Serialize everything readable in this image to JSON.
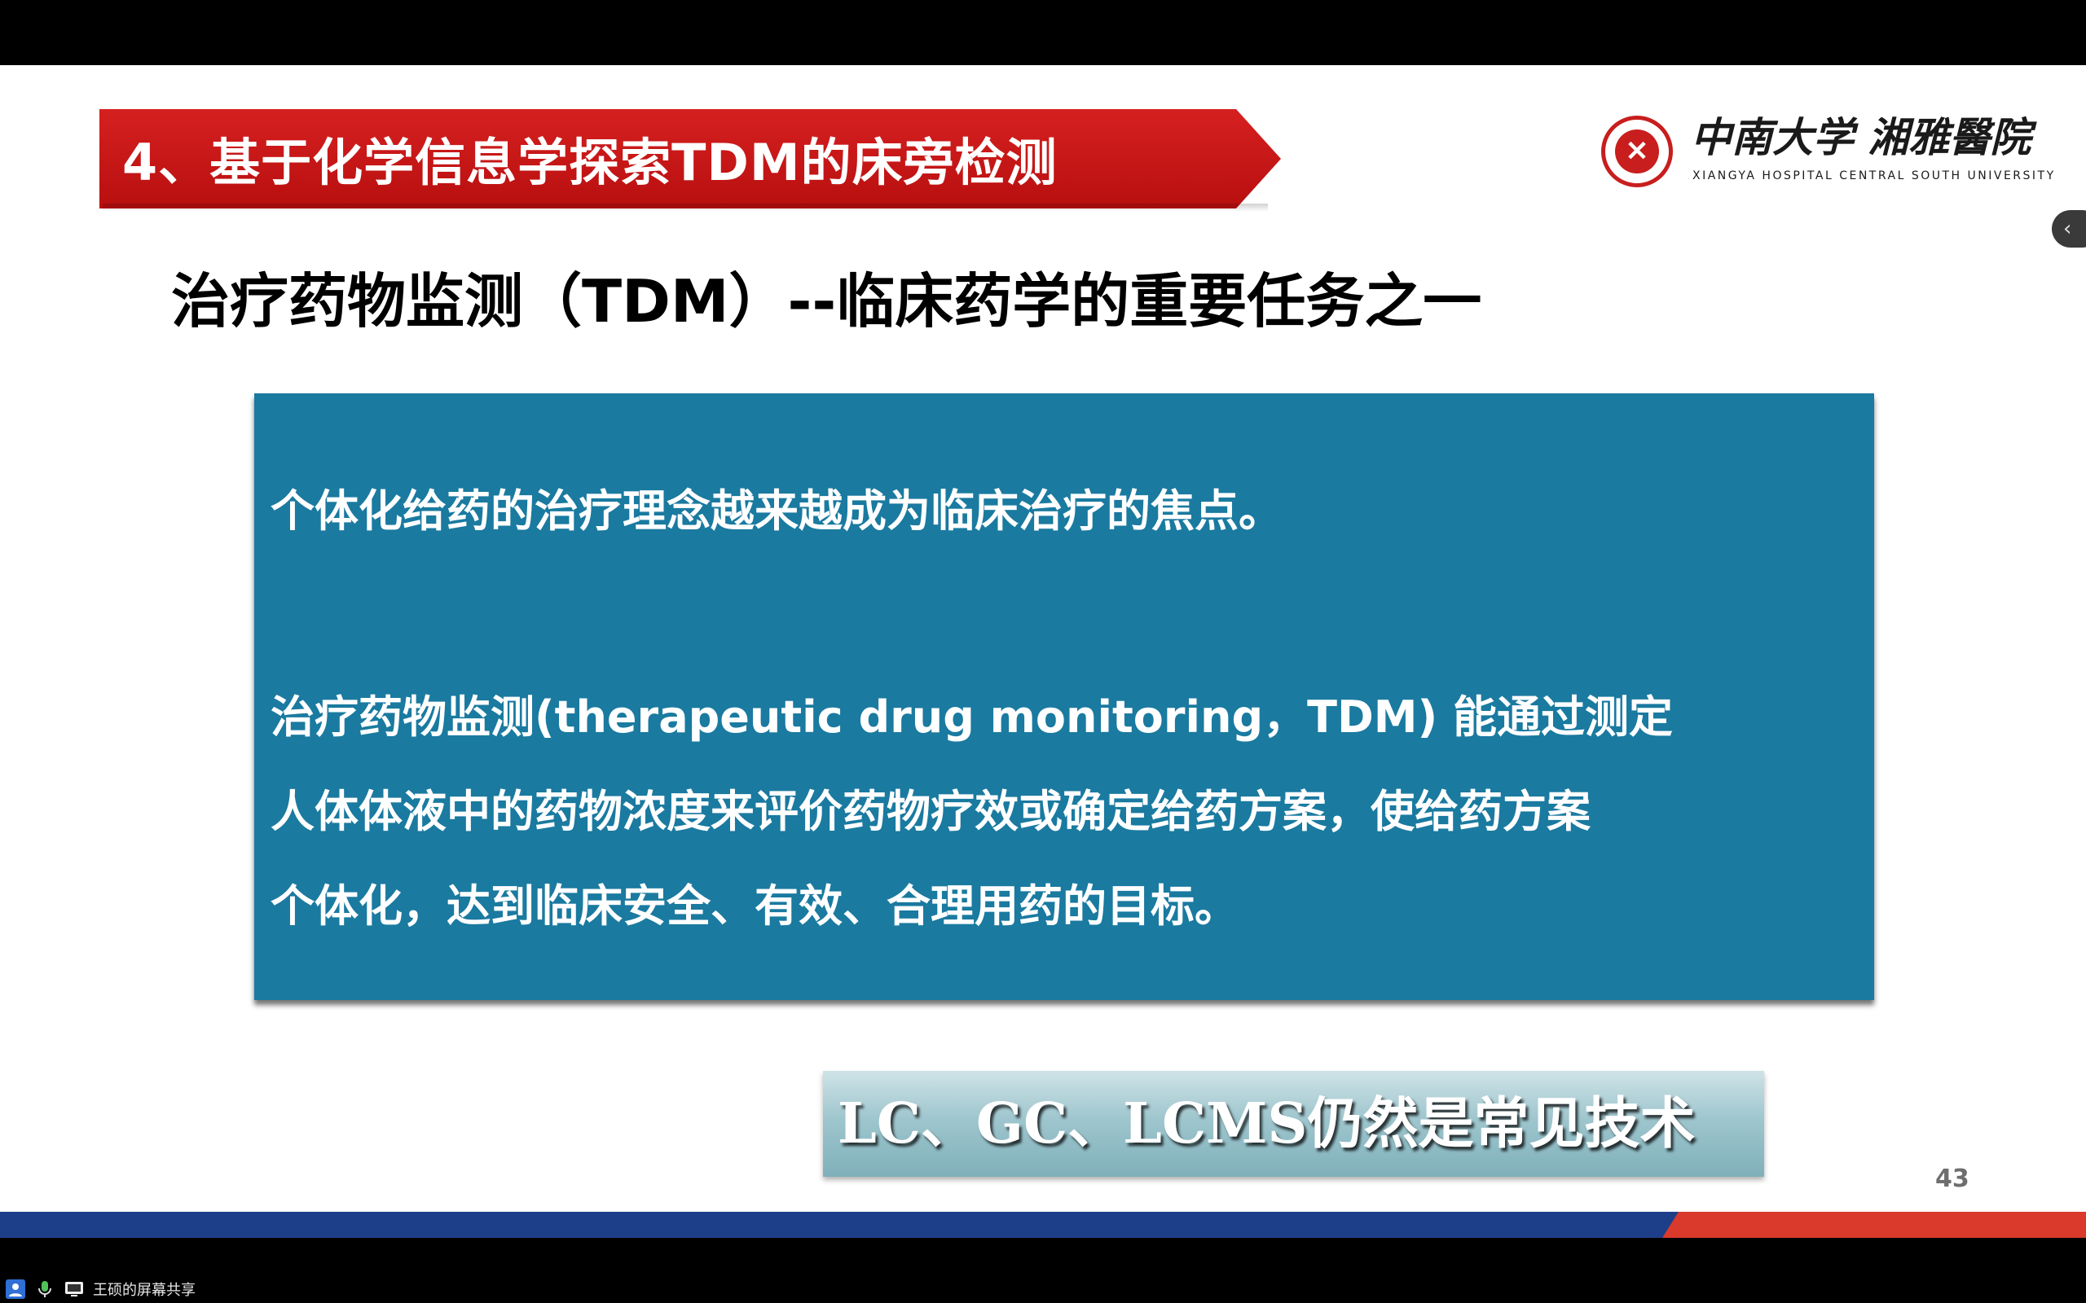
{
  "slide": {
    "title": "4、基于化学信息学探索TDM的床旁检测",
    "logo": {
      "cn": "中南大学 湘雅醫院",
      "en": "XIANGYA HOSPITAL CENTRAL SOUTH UNIVERSITY"
    },
    "subtitle": "治疗药物监测（TDM）--临床药学的重要任务之一",
    "box": {
      "para1": "个体化给药的治疗理念越来越成为临床治疗的焦点。",
      "para2_lines": [
        "治疗药物监测(therapeutic drug monitoring，TDM) 能通过测定",
        "人体体液中的药物浓度来评价药物疗效或确定给药方案，使给药方案",
        "个体化，达到临床安全、有效、合理用药的目标。"
      ]
    },
    "tech_note": "LC、GC、LCMS仍然是常见技术",
    "page_number": "43"
  },
  "sidebar_handle": {
    "icon": "chevron-left-icon",
    "glyph": "‹"
  },
  "status_bar": {
    "label": "王硕的屏幕共享",
    "icons": [
      "user-icon",
      "microphone-icon",
      "screen-share-icon"
    ]
  },
  "colors": {
    "title_red": "#c8151b",
    "box_teal": "#1a7aa0",
    "bar_blue": "#1d3f8a",
    "bar_red": "#d93a2b"
  }
}
